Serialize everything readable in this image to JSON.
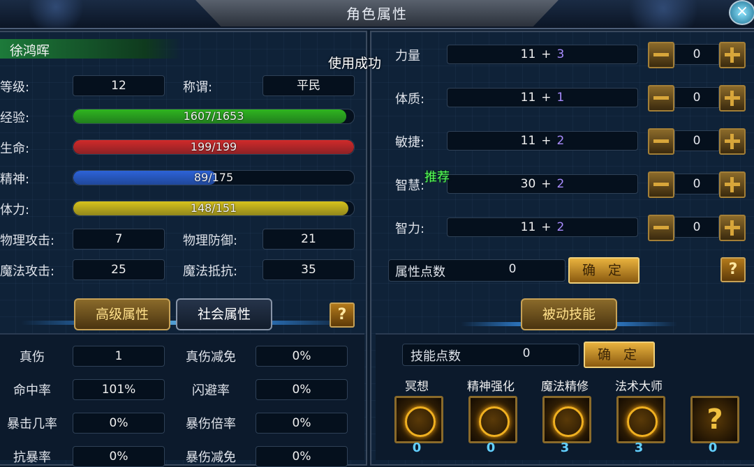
{
  "window": {
    "title": "角色属性",
    "close_icon": "×"
  },
  "character": {
    "name": "徐鸿晖",
    "toast": "使用成功"
  },
  "basic": {
    "level_label": "等级:",
    "level": "12",
    "title_label": "称谓:",
    "title": "平民",
    "exp_label": "经验:",
    "exp_text": "1607/1653",
    "exp_fraction": 0.972,
    "hp_label": "生命:",
    "hp_text": "199/199",
    "hp_fraction": 1.0,
    "spirit_label": "精神:",
    "spirit_text": "89/175",
    "spirit_fraction": 0.509,
    "stamina_label": "体力:",
    "stamina_text": "148/151",
    "stamina_fraction": 0.98,
    "patk_label": "物理攻击:",
    "patk": "7",
    "pdef_label": "物理防御:",
    "pdef": "21",
    "matk_label": "魔法攻击:",
    "matk": "25",
    "mres_label": "魔法抵抗:",
    "mres": "35"
  },
  "tabs": {
    "advanced": "高级属性",
    "social": "社会属性",
    "help": "?"
  },
  "advanced": {
    "rows": [
      {
        "l1": "真伤",
        "v1": "1",
        "l2": "真伤减免",
        "v2": "0%"
      },
      {
        "l1": "命中率",
        "v1": "101%",
        "l2": "闪避率",
        "v2": "0%"
      },
      {
        "l1": "暴击几率",
        "v1": "0%",
        "l2": "暴伤倍率",
        "v2": "0%"
      },
      {
        "l1": "抗暴率",
        "v1": "0%",
        "l2": "暴伤减免",
        "v2": "0%"
      }
    ]
  },
  "attributes": {
    "rows": [
      {
        "label": "力量",
        "base": "11",
        "plus": "+",
        "bonus": "3",
        "alloc": "0"
      },
      {
        "label": "体质:",
        "base": "11",
        "plus": "+",
        "bonus": "1",
        "alloc": "0"
      },
      {
        "label": "敏捷:",
        "base": "11",
        "plus": "+",
        "bonus": "2",
        "alloc": "0"
      },
      {
        "label": "智慧:",
        "base": "30",
        "plus": "+",
        "bonus": "2",
        "alloc": "0"
      },
      {
        "label": "智力:",
        "base": "11",
        "plus": "+",
        "bonus": "2",
        "alloc": "0"
      }
    ],
    "recommend": "推荐",
    "points_label": "属性点数",
    "points": "0",
    "confirm": "确 定",
    "help": "?"
  },
  "skills": {
    "tab": "被动技能",
    "points_label": "技能点数",
    "points": "0",
    "confirm": "确 定",
    "list": [
      {
        "name": "冥想",
        "level": "0",
        "icon": "meditation-icon"
      },
      {
        "name": "精神强化",
        "level": "0",
        "icon": "spirit-boost-icon"
      },
      {
        "name": "魔法精修",
        "level": "3",
        "icon": "magic-mastery-icon"
      },
      {
        "name": "法术大师",
        "level": "3",
        "icon": "spell-master-icon"
      },
      {
        "name": "",
        "level": "0",
        "icon": "unknown-skill-icon"
      }
    ]
  },
  "colors": {
    "exp": "#2fb51f",
    "hp": "#d02a2a",
    "spirit": "#2d63d8",
    "stamina": "#d7c21c",
    "accent": "#c7a257"
  }
}
